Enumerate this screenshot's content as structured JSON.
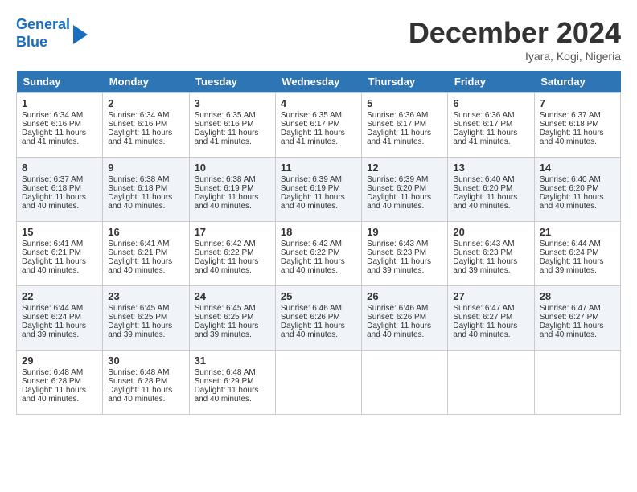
{
  "header": {
    "logo_line1": "General",
    "logo_line2": "Blue",
    "month_title": "December 2024",
    "location": "Iyara, Kogi, Nigeria"
  },
  "days_of_week": [
    "Sunday",
    "Monday",
    "Tuesday",
    "Wednesday",
    "Thursday",
    "Friday",
    "Saturday"
  ],
  "weeks": [
    [
      {
        "num": "1",
        "sunrise": "6:34 AM",
        "sunset": "6:16 PM",
        "daylight": "11 hours and 41 minutes."
      },
      {
        "num": "2",
        "sunrise": "6:34 AM",
        "sunset": "6:16 PM",
        "daylight": "11 hours and 41 minutes."
      },
      {
        "num": "3",
        "sunrise": "6:35 AM",
        "sunset": "6:16 PM",
        "daylight": "11 hours and 41 minutes."
      },
      {
        "num": "4",
        "sunrise": "6:35 AM",
        "sunset": "6:17 PM",
        "daylight": "11 hours and 41 minutes."
      },
      {
        "num": "5",
        "sunrise": "6:36 AM",
        "sunset": "6:17 PM",
        "daylight": "11 hours and 41 minutes."
      },
      {
        "num": "6",
        "sunrise": "6:36 AM",
        "sunset": "6:17 PM",
        "daylight": "11 hours and 41 minutes."
      },
      {
        "num": "7",
        "sunrise": "6:37 AM",
        "sunset": "6:18 PM",
        "daylight": "11 hours and 40 minutes."
      }
    ],
    [
      {
        "num": "8",
        "sunrise": "6:37 AM",
        "sunset": "6:18 PM",
        "daylight": "11 hours and 40 minutes."
      },
      {
        "num": "9",
        "sunrise": "6:38 AM",
        "sunset": "6:18 PM",
        "daylight": "11 hours and 40 minutes."
      },
      {
        "num": "10",
        "sunrise": "6:38 AM",
        "sunset": "6:19 PM",
        "daylight": "11 hours and 40 minutes."
      },
      {
        "num": "11",
        "sunrise": "6:39 AM",
        "sunset": "6:19 PM",
        "daylight": "11 hours and 40 minutes."
      },
      {
        "num": "12",
        "sunrise": "6:39 AM",
        "sunset": "6:20 PM",
        "daylight": "11 hours and 40 minutes."
      },
      {
        "num": "13",
        "sunrise": "6:40 AM",
        "sunset": "6:20 PM",
        "daylight": "11 hours and 40 minutes."
      },
      {
        "num": "14",
        "sunrise": "6:40 AM",
        "sunset": "6:20 PM",
        "daylight": "11 hours and 40 minutes."
      }
    ],
    [
      {
        "num": "15",
        "sunrise": "6:41 AM",
        "sunset": "6:21 PM",
        "daylight": "11 hours and 40 minutes."
      },
      {
        "num": "16",
        "sunrise": "6:41 AM",
        "sunset": "6:21 PM",
        "daylight": "11 hours and 40 minutes."
      },
      {
        "num": "17",
        "sunrise": "6:42 AM",
        "sunset": "6:22 PM",
        "daylight": "11 hours and 40 minutes."
      },
      {
        "num": "18",
        "sunrise": "6:42 AM",
        "sunset": "6:22 PM",
        "daylight": "11 hours and 40 minutes."
      },
      {
        "num": "19",
        "sunrise": "6:43 AM",
        "sunset": "6:23 PM",
        "daylight": "11 hours and 39 minutes."
      },
      {
        "num": "20",
        "sunrise": "6:43 AM",
        "sunset": "6:23 PM",
        "daylight": "11 hours and 39 minutes."
      },
      {
        "num": "21",
        "sunrise": "6:44 AM",
        "sunset": "6:24 PM",
        "daylight": "11 hours and 39 minutes."
      }
    ],
    [
      {
        "num": "22",
        "sunrise": "6:44 AM",
        "sunset": "6:24 PM",
        "daylight": "11 hours and 39 minutes."
      },
      {
        "num": "23",
        "sunrise": "6:45 AM",
        "sunset": "6:25 PM",
        "daylight": "11 hours and 39 minutes."
      },
      {
        "num": "24",
        "sunrise": "6:45 AM",
        "sunset": "6:25 PM",
        "daylight": "11 hours and 39 minutes."
      },
      {
        "num": "25",
        "sunrise": "6:46 AM",
        "sunset": "6:26 PM",
        "daylight": "11 hours and 40 minutes."
      },
      {
        "num": "26",
        "sunrise": "6:46 AM",
        "sunset": "6:26 PM",
        "daylight": "11 hours and 40 minutes."
      },
      {
        "num": "27",
        "sunrise": "6:47 AM",
        "sunset": "6:27 PM",
        "daylight": "11 hours and 40 minutes."
      },
      {
        "num": "28",
        "sunrise": "6:47 AM",
        "sunset": "6:27 PM",
        "daylight": "11 hours and 40 minutes."
      }
    ],
    [
      {
        "num": "29",
        "sunrise": "6:48 AM",
        "sunset": "6:28 PM",
        "daylight": "11 hours and 40 minutes."
      },
      {
        "num": "30",
        "sunrise": "6:48 AM",
        "sunset": "6:28 PM",
        "daylight": "11 hours and 40 minutes."
      },
      {
        "num": "31",
        "sunrise": "6:48 AM",
        "sunset": "6:29 PM",
        "daylight": "11 hours and 40 minutes."
      },
      null,
      null,
      null,
      null
    ]
  ],
  "labels": {
    "sunrise": "Sunrise:",
    "sunset": "Sunset:",
    "daylight": "Daylight:"
  }
}
